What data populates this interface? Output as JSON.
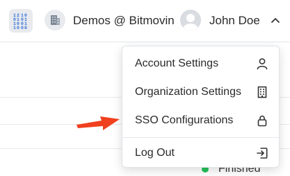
{
  "header": {
    "org_name": "Demos @ Bitmovin",
    "user_name": "John Doe",
    "app_icon": "binary-grid-icon",
    "org_icon": "building-icon",
    "avatar_icon": "user-avatar-icon",
    "expand_icon": "chevron-up-icon"
  },
  "user_menu": {
    "items": [
      {
        "label": "Account Settings",
        "icon": "user-icon"
      },
      {
        "label": "Organization Settings",
        "icon": "building-icon"
      },
      {
        "label": "SSO Configurations",
        "icon": "lock-icon"
      },
      {
        "label": "Log Out",
        "icon": "logout-icon"
      }
    ]
  },
  "background": {
    "status_text": "Finished",
    "status_color": "#25c25a"
  },
  "colors": {
    "accent_blue": "#2f6fd6",
    "annotation_arrow": "#f0401e"
  }
}
